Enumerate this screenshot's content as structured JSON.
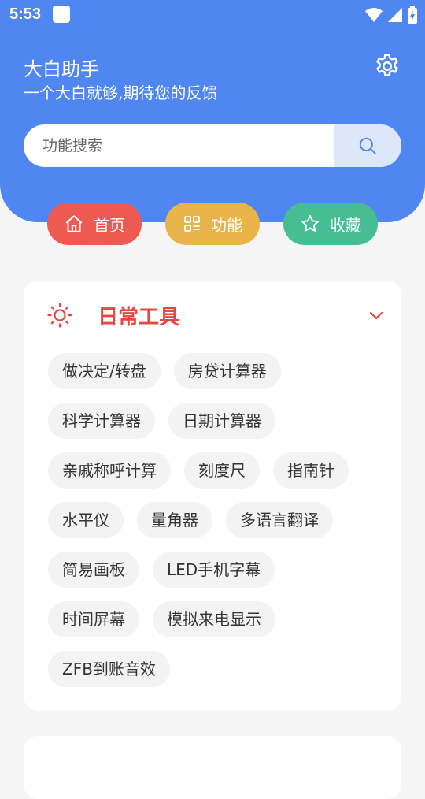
{
  "status_bar": {
    "time": "5:53"
  },
  "header": {
    "title": "大白助手",
    "subtitle": "一个大白就够,期待您的反馈",
    "settings_icon": "gear-icon"
  },
  "search": {
    "placeholder": "功能搜索",
    "value": "",
    "icon": "search-icon"
  },
  "nav": [
    {
      "label": "首页",
      "icon": "home-icon",
      "color": "#ed5a52"
    },
    {
      "label": "功能",
      "icon": "grid-icon",
      "color": "#e9b54a"
    },
    {
      "label": "收藏",
      "icon": "star-icon",
      "color": "#46bd93"
    }
  ],
  "section": {
    "title": "日常工具",
    "title_color": "#e8463f",
    "icon": "sun-icon",
    "expand_icon": "chevron-down-icon",
    "tools": [
      "做决定/转盘",
      "房贷计算器",
      "科学计算器",
      "日期计算器",
      "亲戚称呼计算",
      "刻度尺",
      "指南针",
      "水平仪",
      "量角器",
      "多语言翻译",
      "简易画板",
      "LED手机字幕",
      "时间屏幕",
      "模拟来电显示",
      "ZFB到账音效"
    ]
  },
  "colors": {
    "primary": "#4f86ef",
    "background": "#f5f5f5"
  }
}
